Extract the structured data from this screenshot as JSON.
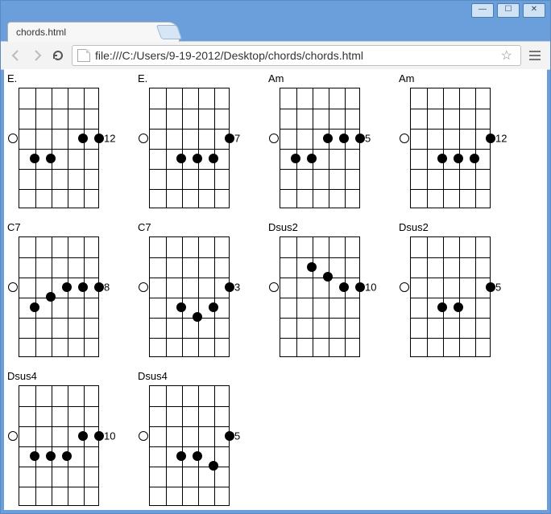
{
  "window": {
    "minimize_glyph": "—",
    "maximize_glyph": "☐",
    "close_glyph": "✕"
  },
  "tab": {
    "title": "chords.html",
    "close_glyph": "×"
  },
  "toolbar": {
    "url": "file:///C:/Users/9-19-2012/Desktop/chords/chords.html",
    "star_glyph": "☆"
  },
  "chords": [
    {
      "name": "E.",
      "fret_label": "12",
      "fret_label_row": 2.5,
      "open_string": 0,
      "open_row": 2.5,
      "dots": [
        {
          "s": 4,
          "r": 2.5
        },
        {
          "s": 5,
          "r": 2.5
        },
        {
          "s": 1,
          "r": 3.5
        },
        {
          "s": 2,
          "r": 3.5
        }
      ]
    },
    {
      "name": "E.",
      "fret_label": "7",
      "fret_label_row": 2.5,
      "open_string": 0,
      "open_row": 2.5,
      "dots": [
        {
          "s": 5,
          "r": 2.5
        },
        {
          "s": 2,
          "r": 3.5
        },
        {
          "s": 3,
          "r": 3.5
        },
        {
          "s": 4,
          "r": 3.5
        }
      ]
    },
    {
      "name": "Am",
      "fret_label": "5",
      "fret_label_row": 2.5,
      "open_string": 0,
      "open_row": 2.5,
      "dots": [
        {
          "s": 3,
          "r": 2.5
        },
        {
          "s": 4,
          "r": 2.5
        },
        {
          "s": 5,
          "r": 2.5
        },
        {
          "s": 1,
          "r": 3.5
        },
        {
          "s": 2,
          "r": 3.5
        }
      ]
    },
    {
      "name": "Am",
      "fret_label": "12",
      "fret_label_row": 2.5,
      "open_string": 0,
      "open_row": 2.5,
      "dots": [
        {
          "s": 5,
          "r": 2.5
        },
        {
          "s": 2,
          "r": 3.5
        },
        {
          "s": 3,
          "r": 3.5
        },
        {
          "s": 4,
          "r": 3.5
        }
      ]
    },
    {
      "name": "C7",
      "fret_label": "8",
      "fret_label_row": 2.5,
      "open_string": 0,
      "open_row": 2.5,
      "dots": [
        {
          "s": 3,
          "r": 2.5
        },
        {
          "s": 4,
          "r": 2.5
        },
        {
          "s": 5,
          "r": 2.5
        },
        {
          "s": 2,
          "r": 3.0
        },
        {
          "s": 1,
          "r": 3.5
        }
      ]
    },
    {
      "name": "C7",
      "fret_label": "3",
      "fret_label_row": 2.5,
      "open_string": 0,
      "open_row": 2.5,
      "dots": [
        {
          "s": 5,
          "r": 2.5
        },
        {
          "s": 2,
          "r": 3.5
        },
        {
          "s": 4,
          "r": 3.5
        },
        {
          "s": 3,
          "r": 4.0
        }
      ]
    },
    {
      "name": "Dsus2",
      "fret_label": "10",
      "fret_label_row": 2.5,
      "open_string": 0,
      "open_row": 2.5,
      "dots": [
        {
          "s": 2,
          "r": 1.5
        },
        {
          "s": 3,
          "r": 2.0
        },
        {
          "s": 4,
          "r": 2.5
        },
        {
          "s": 5,
          "r": 2.5
        }
      ]
    },
    {
      "name": "Dsus2",
      "fret_label": "5",
      "fret_label_row": 2.5,
      "open_string": 0,
      "open_row": 2.5,
      "dots": [
        {
          "s": 5,
          "r": 2.5
        },
        {
          "s": 2,
          "r": 3.5
        },
        {
          "s": 3,
          "r": 3.5
        }
      ]
    },
    {
      "name": "Dsus4",
      "fret_label": "10",
      "fret_label_row": 2.5,
      "open_string": 0,
      "open_row": 2.5,
      "dots": [
        {
          "s": 4,
          "r": 2.5
        },
        {
          "s": 5,
          "r": 2.5
        },
        {
          "s": 1,
          "r": 3.5
        },
        {
          "s": 2,
          "r": 3.5
        },
        {
          "s": 3,
          "r": 3.5
        }
      ]
    },
    {
      "name": "Dsus4",
      "fret_label": "5",
      "fret_label_row": 2.5,
      "open_string": 0,
      "open_row": 2.5,
      "dots": [
        {
          "s": 5,
          "r": 2.5
        },
        {
          "s": 2,
          "r": 3.5
        },
        {
          "s": 3,
          "r": 3.5
        },
        {
          "s": 4,
          "r": 4.0
        }
      ]
    }
  ]
}
